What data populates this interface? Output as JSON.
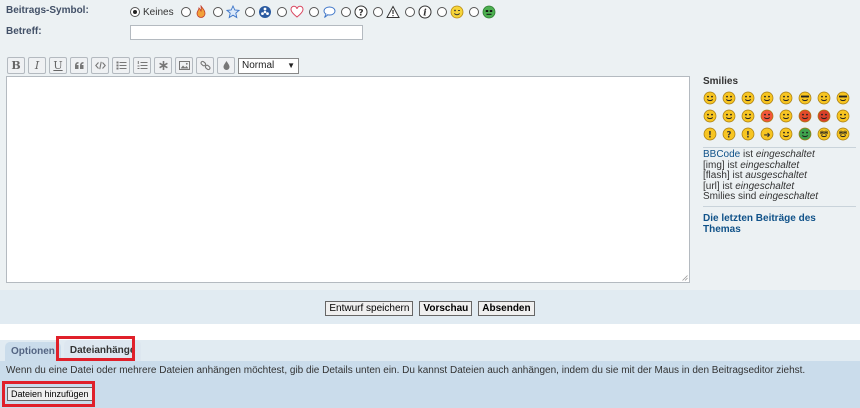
{
  "labels": {
    "post_icon": "Beitrags-Symbol:",
    "subject": "Betreff:"
  },
  "post_icons": {
    "none_label": "Keines",
    "icons": [
      "fire-icon",
      "star-icon",
      "radioactive-icon",
      "heart-icon",
      "speech-bubble-icon",
      "question-icon",
      "warning-icon",
      "info-icon",
      "wink-icon",
      "alien-icon"
    ]
  },
  "subject_value": "",
  "toolbar": {
    "buttons": [
      "B",
      "I",
      "U"
    ],
    "size_select": "Normal"
  },
  "editor_value": "",
  "sidebar": {
    "title": "Smilies",
    "info": [
      {
        "a": "BBCode",
        "b": " ist ",
        "c": "eingeschaltet"
      },
      {
        "a": "[img]",
        "b": " ist ",
        "c": "eingeschaltet"
      },
      {
        "a": "[flash]",
        "b": " ist ",
        "c": "ausgeschaltet"
      },
      {
        "a": "[url]",
        "b": " ist ",
        "c": "eingeschaltet"
      },
      {
        "a": "Smilies",
        "b": " sind ",
        "c": "eingeschaltet"
      }
    ],
    "last_posts": "Die letzten Beiträge des Themas"
  },
  "buttons": {
    "save_draft": "Entwurf speichern",
    "preview": "Vorschau",
    "submit": "Absenden"
  },
  "tabs": [
    {
      "label": "Optionen"
    },
    {
      "label": "Dateianhänge"
    }
  ],
  "attach": {
    "text": "Wenn du eine Datei oder mehrere Dateien anhängen möchtest, gib die Details unten ein. Du kannst Dateien auch anhängen, indem du sie mit der Maus in den Beitragseditor ziehst.",
    "add_button": "Dateien hinzufügen"
  },
  "colors": {
    "highlight": "#e0202a",
    "link": "#105289"
  }
}
